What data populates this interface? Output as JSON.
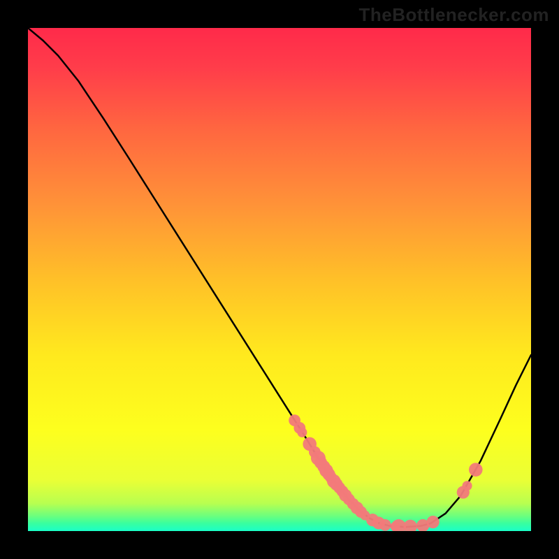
{
  "watermark": "TheBottlenecker.com",
  "chart_data": {
    "type": "line",
    "title": "",
    "xlabel": "",
    "ylabel": "",
    "xlim": [
      0,
      100
    ],
    "ylim": [
      0,
      100
    ],
    "background": {
      "kind": "vertical-gradient",
      "stops": [
        {
          "offset": 0.0,
          "color": "#ff2a4a"
        },
        {
          "offset": 0.08,
          "color": "#ff3d4a"
        },
        {
          "offset": 0.2,
          "color": "#ff6640"
        },
        {
          "offset": 0.35,
          "color": "#ff9238"
        },
        {
          "offset": 0.5,
          "color": "#ffc028"
        },
        {
          "offset": 0.65,
          "color": "#ffe91e"
        },
        {
          "offset": 0.8,
          "color": "#fdff1e"
        },
        {
          "offset": 0.9,
          "color": "#e9ff36"
        },
        {
          "offset": 0.945,
          "color": "#b8ff50"
        },
        {
          "offset": 0.97,
          "color": "#6cff7e"
        },
        {
          "offset": 0.985,
          "color": "#38ffa0"
        },
        {
          "offset": 1.0,
          "color": "#1affc8"
        }
      ]
    },
    "curve": [
      {
        "x": 0,
        "y": 100.0
      },
      {
        "x": 3,
        "y": 97.5
      },
      {
        "x": 6,
        "y": 94.5
      },
      {
        "x": 10,
        "y": 89.5
      },
      {
        "x": 15,
        "y": 82.0
      },
      {
        "x": 20,
        "y": 74.2
      },
      {
        "x": 25,
        "y": 66.3
      },
      {
        "x": 30,
        "y": 58.4
      },
      {
        "x": 35,
        "y": 50.5
      },
      {
        "x": 40,
        "y": 42.6
      },
      {
        "x": 45,
        "y": 34.7
      },
      {
        "x": 50,
        "y": 26.8
      },
      {
        "x": 55,
        "y": 18.9
      },
      {
        "x": 58,
        "y": 14.0
      },
      {
        "x": 60,
        "y": 11.0
      },
      {
        "x": 62,
        "y": 8.5
      },
      {
        "x": 64,
        "y": 6.0
      },
      {
        "x": 66,
        "y": 4.0
      },
      {
        "x": 68,
        "y": 2.5
      },
      {
        "x": 70,
        "y": 1.5
      },
      {
        "x": 72,
        "y": 1.0
      },
      {
        "x": 75,
        "y": 0.8
      },
      {
        "x": 78,
        "y": 1.0
      },
      {
        "x": 80,
        "y": 1.5
      },
      {
        "x": 83,
        "y": 3.5
      },
      {
        "x": 86,
        "y": 7.0
      },
      {
        "x": 90,
        "y": 14.0
      },
      {
        "x": 94,
        "y": 22.5
      },
      {
        "x": 97,
        "y": 29.0
      },
      {
        "x": 100,
        "y": 35.0
      }
    ],
    "markers": [
      {
        "x": 53.0,
        "y": 22.0,
        "r": 1.2
      },
      {
        "x": 54.0,
        "y": 20.5,
        "r": 1.2
      },
      {
        "x": 54.5,
        "y": 19.6,
        "r": 1.0
      },
      {
        "x": 56.0,
        "y": 17.3,
        "r": 1.4
      },
      {
        "x": 57.0,
        "y": 15.7,
        "r": 1.2
      },
      {
        "x": 57.7,
        "y": 14.5,
        "r": 1.5
      },
      {
        "x": 58.2,
        "y": 13.6,
        "r": 1.3
      },
      {
        "x": 58.8,
        "y": 12.8,
        "r": 1.3
      },
      {
        "x": 59.3,
        "y": 12.0,
        "r": 1.4
      },
      {
        "x": 59.8,
        "y": 11.3,
        "r": 1.3
      },
      {
        "x": 60.2,
        "y": 10.7,
        "r": 1.2
      },
      {
        "x": 60.8,
        "y": 9.9,
        "r": 1.4
      },
      {
        "x": 61.3,
        "y": 9.3,
        "r": 1.3
      },
      {
        "x": 61.9,
        "y": 8.6,
        "r": 1.2
      },
      {
        "x": 62.5,
        "y": 7.9,
        "r": 1.2
      },
      {
        "x": 63.1,
        "y": 7.1,
        "r": 1.3
      },
      {
        "x": 63.8,
        "y": 6.3,
        "r": 1.2
      },
      {
        "x": 64.6,
        "y": 5.4,
        "r": 1.2
      },
      {
        "x": 65.4,
        "y": 4.6,
        "r": 1.3
      },
      {
        "x": 66.2,
        "y": 3.8,
        "r": 1.2
      },
      {
        "x": 67.0,
        "y": 3.1,
        "r": 1.0
      },
      {
        "x": 68.5,
        "y": 2.2,
        "r": 1.3
      },
      {
        "x": 69.7,
        "y": 1.6,
        "r": 1.3
      },
      {
        "x": 71.0,
        "y": 1.2,
        "r": 1.2
      },
      {
        "x": 73.0,
        "y": 0.9,
        "r": 1.0
      },
      {
        "x": 73.7,
        "y": 0.9,
        "r": 1.5
      },
      {
        "x": 76.0,
        "y": 0.9,
        "r": 1.4
      },
      {
        "x": 78.5,
        "y": 1.1,
        "r": 1.3
      },
      {
        "x": 80.5,
        "y": 1.8,
        "r": 1.3
      },
      {
        "x": 86.5,
        "y": 7.7,
        "r": 1.3
      },
      {
        "x": 87.3,
        "y": 9.0,
        "r": 1.0
      },
      {
        "x": 89.0,
        "y": 12.2,
        "r": 1.4
      }
    ],
    "marker_color": "#f27a7a"
  }
}
